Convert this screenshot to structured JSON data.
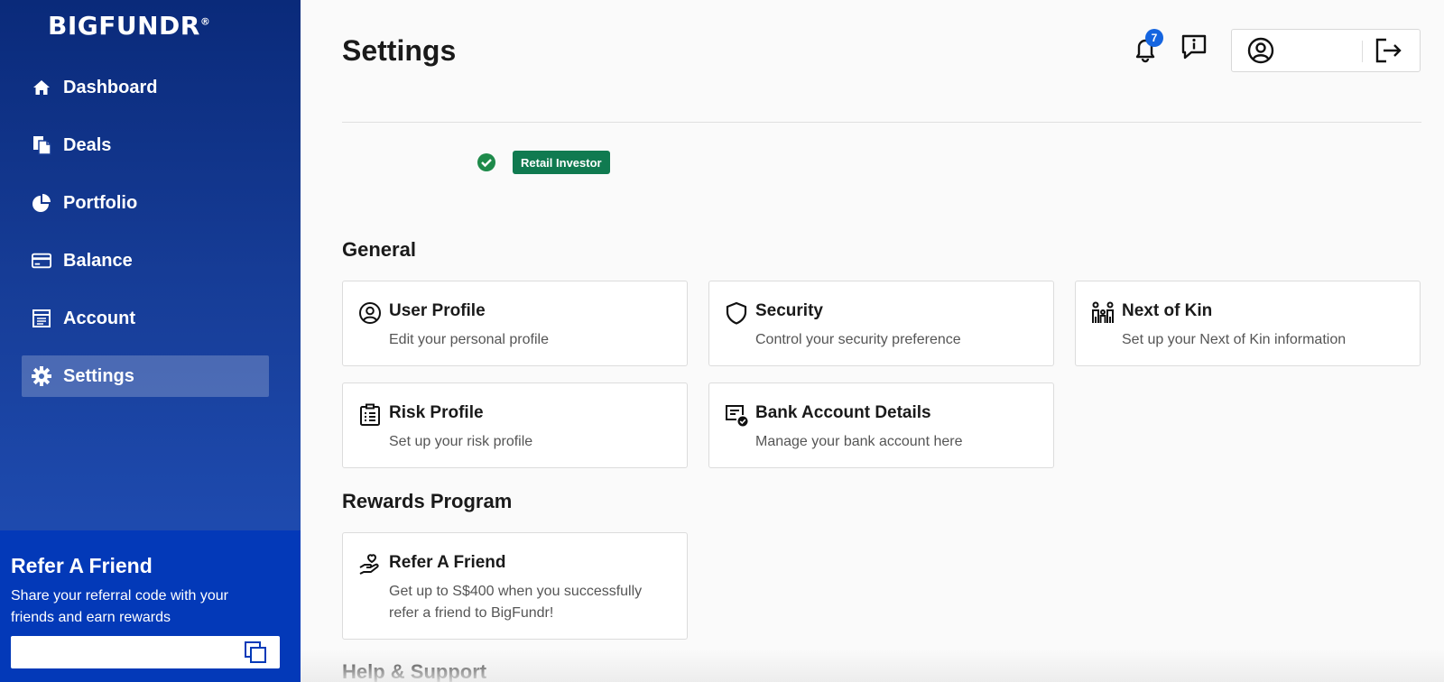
{
  "brand": {
    "logo_text": "BIGFUNDR",
    "logo_mark": "®"
  },
  "sidebar": {
    "items": [
      {
        "label": "Dashboard",
        "icon": "home-icon"
      },
      {
        "label": "Deals",
        "icon": "documents-icon"
      },
      {
        "label": "Portfolio",
        "icon": "pie-chart-icon"
      },
      {
        "label": "Balance",
        "icon": "credit-card-icon"
      },
      {
        "label": "Account",
        "icon": "ledger-icon"
      },
      {
        "label": "Settings",
        "icon": "gear-icon",
        "active": true
      }
    ],
    "refer": {
      "title": "Refer A Friend",
      "description": "Share your referral code with your friends and earn rewards",
      "code_value": ""
    }
  },
  "header": {
    "title": "Settings",
    "notification_count": "7"
  },
  "status": {
    "investor_tag": "Retail Investor"
  },
  "sections": {
    "general": {
      "title": "General",
      "cards": [
        {
          "title": "User Profile",
          "description": "Edit your personal profile",
          "icon": "user-circle-icon"
        },
        {
          "title": "Security",
          "description": "Control your security preference",
          "icon": "shield-icon"
        },
        {
          "title": "Next of Kin",
          "description": "Set up your Next of Kin information",
          "icon": "family-icon"
        },
        {
          "title": "Risk Profile",
          "description": "Set up your risk profile",
          "icon": "clipboard-list-icon"
        },
        {
          "title": "Bank Account Details",
          "description": "Manage your bank account here",
          "icon": "bank-check-icon"
        }
      ]
    },
    "rewards": {
      "title": "Rewards Program",
      "cards": [
        {
          "title": "Refer A Friend",
          "description": "Get up to S$400 when you successfully refer a friend to BigFundr!",
          "icon": "hand-heart-icon"
        }
      ]
    },
    "help": {
      "title": "Help & Support"
    }
  },
  "colors": {
    "sidebar_top": "#0a2a7a",
    "sidebar_bottom": "#2353bd",
    "refer_bg": "#0339b8",
    "tag_green": "#107a50",
    "badge_blue": "#1565e0",
    "check_green": "#1e8a4a"
  }
}
